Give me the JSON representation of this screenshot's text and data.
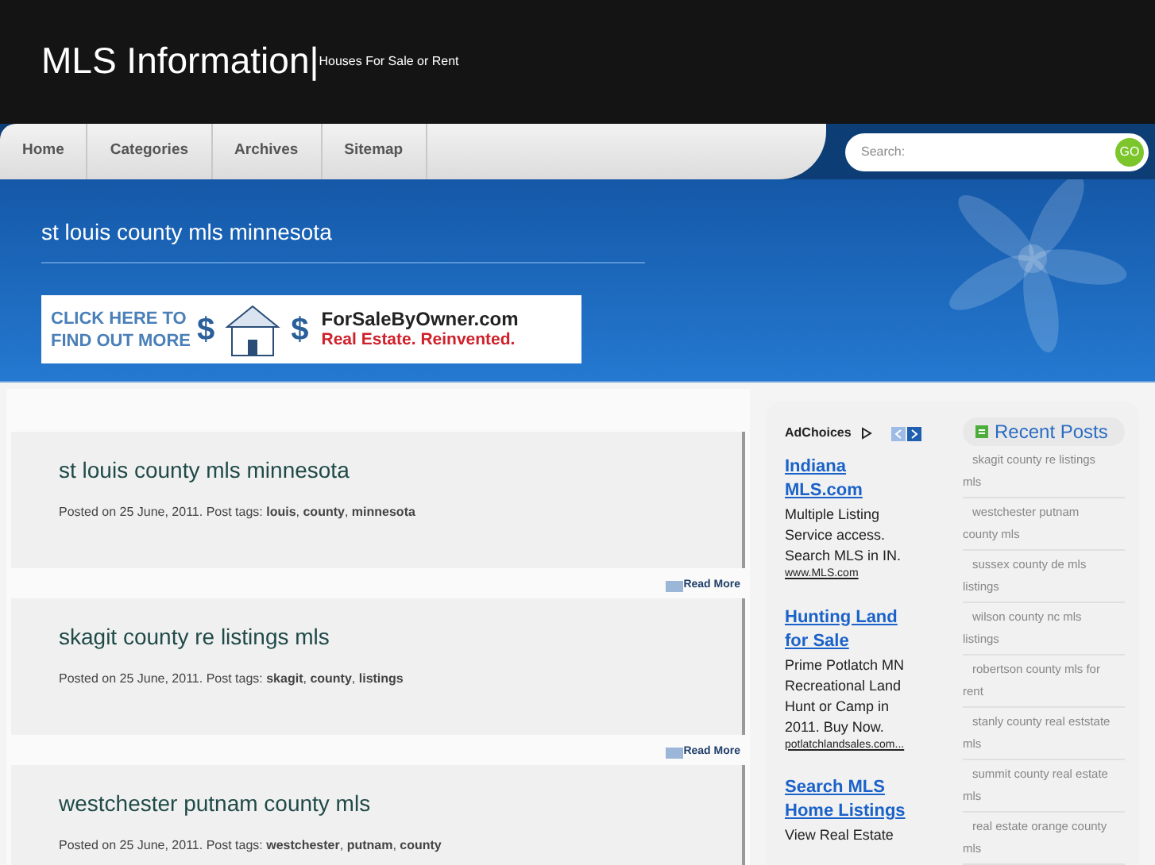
{
  "header": {
    "title": "MLS Information",
    "separator": "|",
    "tagline": "Houses For Sale or Rent"
  },
  "nav": {
    "items": [
      {
        "label": "Home"
      },
      {
        "label": "Categories"
      },
      {
        "label": "Archives"
      },
      {
        "label": "Sitemap"
      }
    ],
    "search": {
      "placeholder": "Search:",
      "button": "GO"
    }
  },
  "page_title": "st louis county mls minnesota",
  "banner_ad": {
    "left_line_1": "CLICK HERE TO",
    "left_line_2": "FIND OUT MORE",
    "symbol_left": "$",
    "symbol_right": "$",
    "brand": "ForSaleByOwner.com",
    "slogan": "Real Estate. Reinvented."
  },
  "posts": [
    {
      "title": "st louis county mls minnesota",
      "meta": "Posted on 25 June, 2011. Post tags: **louis**, **county**, **minnesota**",
      "read_more": "Read More"
    },
    {
      "title": "skagit county re listings mls",
      "meta": "Posted on 25 June, 2011. Post tags: **skagit**, **county**, **listings**",
      "read_more": "Read More"
    },
    {
      "title": "westchester putnam county mls",
      "meta": "Posted on 25 June, 2011. Post tags: **westchester**, **putnam**, **county**"
    }
  ],
  "ads": {
    "label": "AdChoices",
    "items": [
      {
        "title": "Indiana MLS.com",
        "body": "Multiple Listing Service access. Search MLS in IN.",
        "url": "www.MLS.com"
      },
      {
        "title": "Hunting Land for Sale",
        "body": "Prime Potlatch MN Recreational Land Hunt or Camp in 2011. Buy Now.",
        "url": "potlatchlandsales.com..."
      },
      {
        "title": "Search MLS Home Listings",
        "body": "View Real Estate"
      }
    ]
  },
  "recent_posts": {
    "title": "Recent Posts",
    "items": [
      "skagit county re listings mls",
      "westchester putnam county mls",
      "sussex county de mls listings",
      "wilson county nc mls listings",
      "robertson county mls for rent",
      "stanly county real eststate mls",
      "summit county real estate mls",
      "real estate orange county mls"
    ]
  }
}
